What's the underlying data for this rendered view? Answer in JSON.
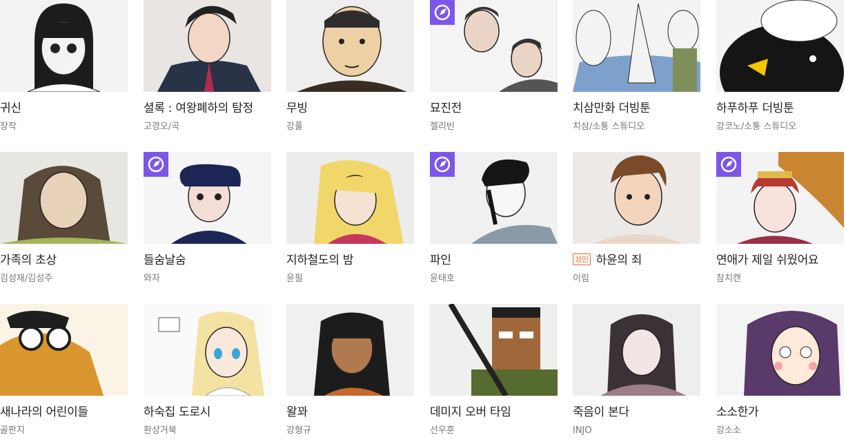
{
  "colors": {
    "badge": "#7b56e8",
    "adult_label": "#ee6a2b",
    "title": "#222222",
    "author": "#777777"
  },
  "cards": [
    {
      "title": "귀신",
      "author": "장작",
      "badge": false,
      "adult": false,
      "art": "girl-bob",
      "colors": [
        "#f2f2f2",
        "#1c1c1c",
        "#ffffff"
      ]
    },
    {
      "title": "셜록 : 여왕폐하의 탐정",
      "author": "고경오/곡",
      "badge": false,
      "adult": false,
      "art": "suit-man",
      "colors": [
        "#e9e5e3",
        "#283347",
        "#b22b4d"
      ]
    },
    {
      "title": "무빙",
      "author": "강풀",
      "badge": false,
      "adult": false,
      "art": "round-man",
      "colors": [
        "#f0eeec",
        "#eed0a5",
        "#2d2d2d"
      ]
    },
    {
      "title": "묘진전",
      "author": "젤리빈",
      "badge": true,
      "adult": false,
      "art": "two-men",
      "colors": [
        "#f4f4f4",
        "#555555",
        "#e9d4c6"
      ]
    },
    {
      "title": "치삼만화 더빙툰",
      "author": "치삼/소통 스튜디오",
      "badge": false,
      "adult": false,
      "art": "three-heads",
      "colors": [
        "#f3f3f3",
        "#7ea0cc",
        "#7f8f5b"
      ]
    },
    {
      "title": "하푸하푸 더빙툰",
      "author": "강코노/소통 스튜디오",
      "badge": false,
      "adult": false,
      "art": "penguin",
      "colors": [
        "#f3f3f3",
        "#151515",
        "#f5c400"
      ]
    },
    {
      "title": "가족의 초상",
      "author": "김성재/김성주",
      "badge": false,
      "adult": false,
      "art": "woman-long",
      "colors": [
        "#e8e6e0",
        "#5a4a3a",
        "#a4b35c"
      ]
    },
    {
      "title": "들숨날숨",
      "author": "와자",
      "badge": true,
      "adult": false,
      "art": "pompadour",
      "colors": [
        "#f5f5f5",
        "#1b2654",
        "#f3ddd5"
      ]
    },
    {
      "title": "지하철도의 밤",
      "author": "윤필",
      "badge": false,
      "adult": false,
      "art": "blonde-girl",
      "colors": [
        "#ececec",
        "#f1d66a",
        "#c8385d"
      ]
    },
    {
      "title": "파인",
      "author": "윤태호",
      "badge": true,
      "adult": false,
      "art": "ink-man",
      "colors": [
        "#f0f0f0",
        "#151515",
        "#8a9aa6"
      ]
    },
    {
      "title": "하윤의 죄",
      "author": "이림",
      "badge": false,
      "adult": true,
      "adult_label": "성인",
      "art": "boy",
      "colors": [
        "#ede9e6",
        "#7a4a2a",
        "#f3d4bd"
      ]
    },
    {
      "title": "연애가 제일 쉬웠어요",
      "author": "참치캔",
      "badge": true,
      "adult": false,
      "art": "tiger-girl",
      "colors": [
        "#f3f3f3",
        "#c9852f",
        "#9b2d45"
      ]
    },
    {
      "title": "새나라의 어린이들",
      "author": "골판지",
      "badge": false,
      "adult": false,
      "art": "glasses-kid",
      "colors": [
        "#fbf3e6",
        "#d9962e",
        "#1e1e1e"
      ]
    },
    {
      "title": "하숙집 도로시",
      "author": "환상거북",
      "badge": false,
      "adult": false,
      "art": "anime-blonde",
      "colors": [
        "#fafafa",
        "#f3e2a2",
        "#3aa6d9"
      ]
    },
    {
      "title": "왈꽈",
      "author": "강형규",
      "badge": false,
      "adult": false,
      "art": "dark-woman",
      "colors": [
        "#f0f0f0",
        "#1c1c1c",
        "#b07a4e"
      ]
    },
    {
      "title": "데미지 오버 타임",
      "author": "선우훈",
      "badge": false,
      "adult": false,
      "art": "pixel-soldier",
      "colors": [
        "#eef0ee",
        "#556b2f",
        "#a0683a"
      ]
    },
    {
      "title": "죽음이 본다",
      "author": "INJO",
      "badge": false,
      "adult": false,
      "art": "hooded-woman",
      "colors": [
        "#eeeeee",
        "#3a3236",
        "#9b7e86"
      ]
    },
    {
      "title": "소소한가",
      "author": "강소소",
      "badge": false,
      "adult": false,
      "art": "cartoon-girl",
      "colors": [
        "#f4f4f4",
        "#5a3a6a",
        "#ffe9d9"
      ]
    }
  ]
}
